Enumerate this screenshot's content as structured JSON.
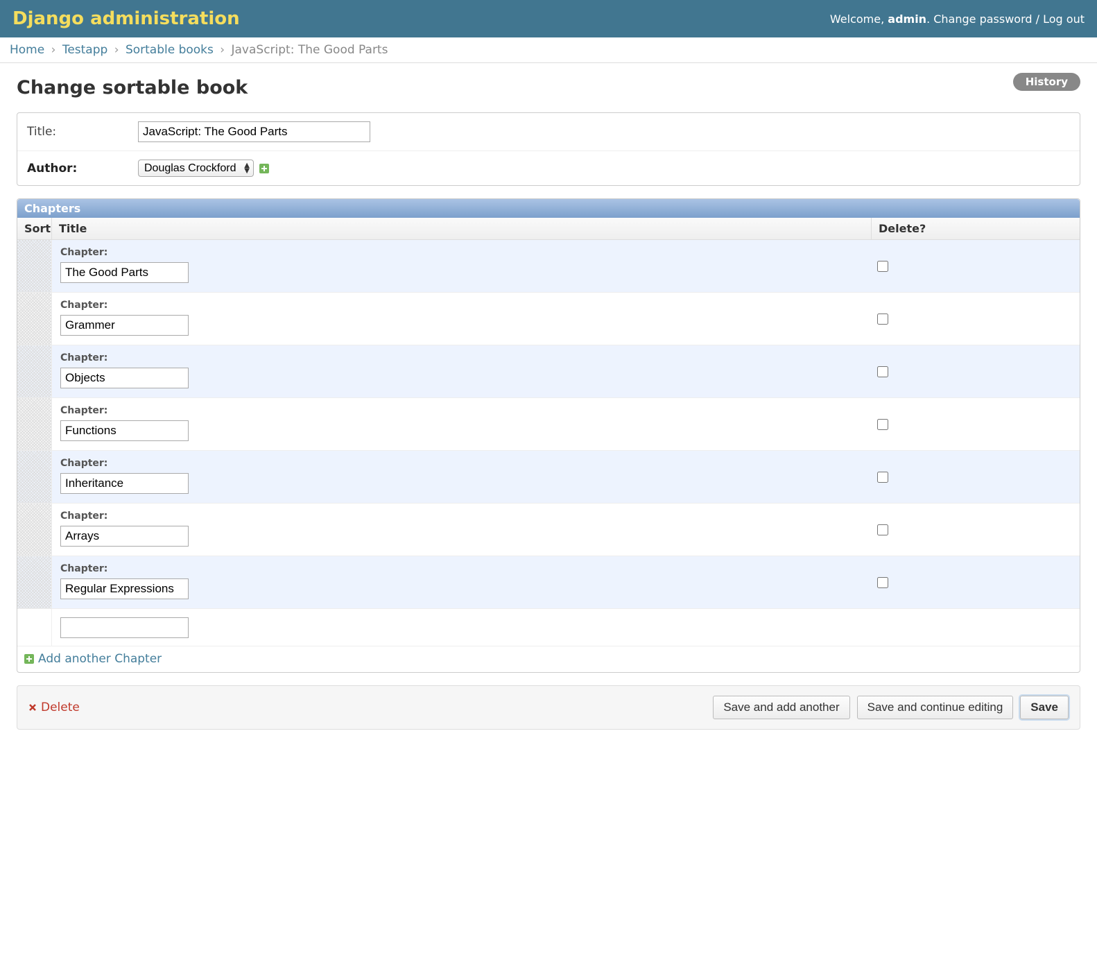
{
  "header": {
    "branding": "Django administration",
    "welcome_prefix": "Welcome, ",
    "username": "admin",
    "welcome_suffix": ". ",
    "change_password": "Change password",
    "sep": " / ",
    "logout": "Log out"
  },
  "breadcrumbs": {
    "home": "Home",
    "app": "Testapp",
    "model": "Sortable books",
    "current": "JavaScript: The Good Parts",
    "sep": "›"
  },
  "object_tools": {
    "history": "History"
  },
  "page_title": "Change sortable book",
  "form": {
    "title_label": "Title:",
    "title_value": "JavaScript: The Good Parts",
    "author_label": "Author:",
    "author_value": "Douglas Crockford"
  },
  "inline": {
    "heading": "Chapters",
    "col_sort": "Sort",
    "col_title": "Title",
    "col_delete": "Delete?",
    "chapter_label": "Chapter:",
    "rows": [
      {
        "title": "The Good Parts"
      },
      {
        "title": "Grammer"
      },
      {
        "title": "Objects"
      },
      {
        "title": "Functions"
      },
      {
        "title": "Inheritance"
      },
      {
        "title": "Arrays"
      },
      {
        "title": "Regular Expressions"
      }
    ],
    "add_another": "Add another Chapter"
  },
  "actions": {
    "delete": "Delete",
    "save_add_another": "Save and add another",
    "save_continue": "Save and continue editing",
    "save": "Save"
  }
}
